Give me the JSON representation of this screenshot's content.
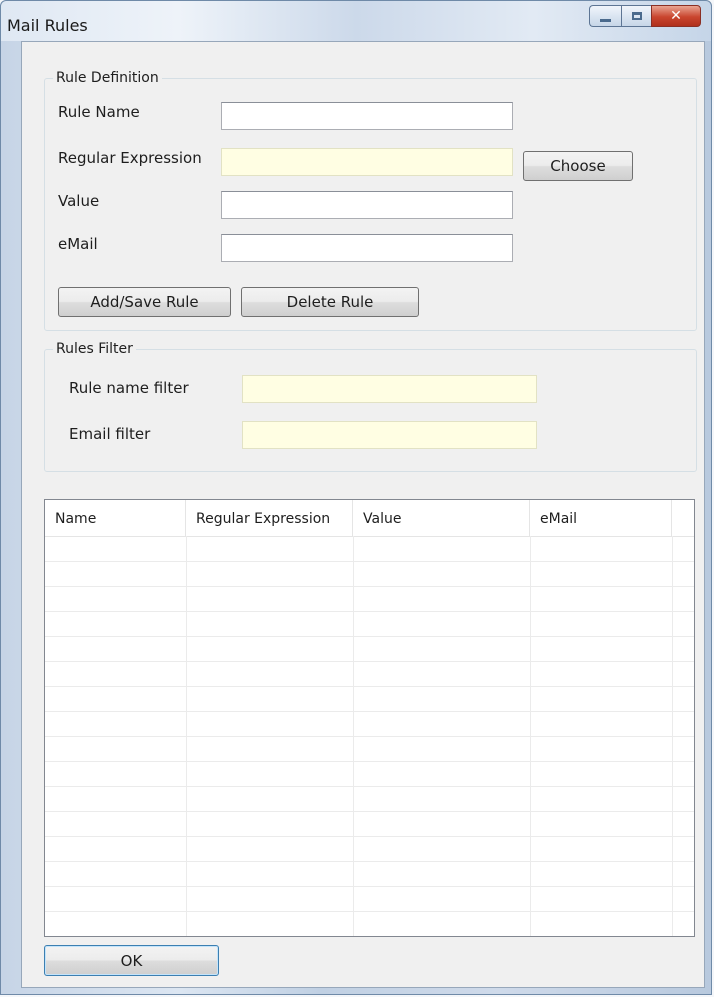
{
  "window": {
    "title": "Mail Rules",
    "close_glyph": "✕"
  },
  "rule_definition": {
    "legend": "Rule Definition",
    "rule_name_label": "Rule Name",
    "rule_name_value": "",
    "regex_label": "Regular Expression",
    "regex_value": "",
    "choose_label": "Choose",
    "value_label": "Value",
    "value_value": "",
    "email_label": "eMail",
    "email_value": "",
    "add_save_label": "Add/Save Rule",
    "delete_label": "Delete Rule"
  },
  "rules_filter": {
    "legend": "Rules Filter",
    "rule_name_filter_label": "Rule name filter",
    "rule_name_filter_value": "",
    "email_filter_label": "Email filter",
    "email_filter_value": ""
  },
  "grid": {
    "columns": [
      "Name",
      "Regular Expression",
      "Value",
      "eMail"
    ],
    "rows": []
  },
  "footer": {
    "ok_label": "OK"
  },
  "colors": {
    "filter_field_background": "#fffee3",
    "close_button": "#c9452e"
  }
}
